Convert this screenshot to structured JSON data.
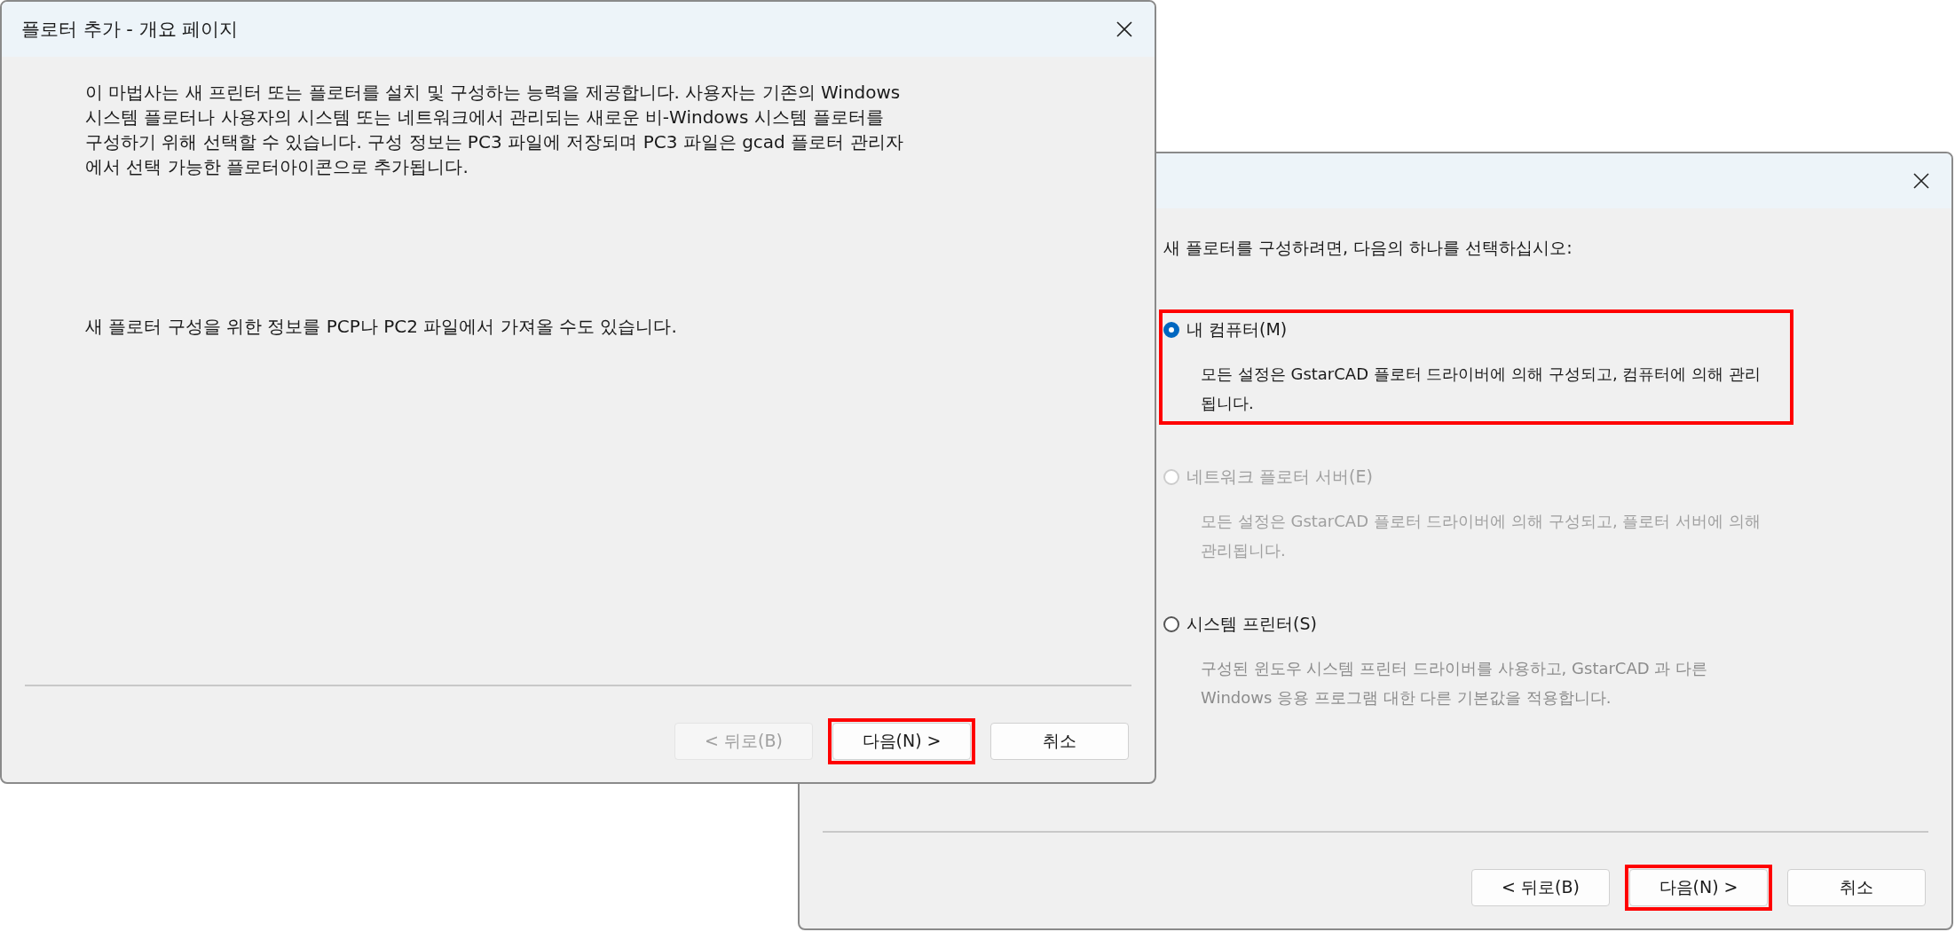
{
  "windows": [
    {
      "title": "플로터 추가 - 개요 페이지",
      "paragraphs": [
        "이 마법사는 새 프린터 또는 플로터를 설치 및 구성하는 능력을 제공합니다. 사용자는 기존의 Windows 시스템 플로터나 사용자의 시스템 또는 네트워크에서 관리되는 새로운 비-Windows 시스템 플로터를 구성하기 위해 선택할 수 있습니다. 구성 정보는 PC3 파일에 저장되며 PC3 파일은 gcad 플로터 관리자에서 선택 가능한 플로터아이콘으로 추가됩니다.",
        "새 플로터 구성을 위한 정보를 PCP나 PC2 파일에서 가져올 수도 있습니다."
      ],
      "buttons": [
        {
          "label": "< 뒤로(B)",
          "disabled": true,
          "highlighted": false
        },
        {
          "label": "다음(N) >",
          "disabled": false,
          "highlighted": true
        },
        {
          "label": "취소",
          "disabled": false,
          "highlighted": false
        }
      ]
    },
    {
      "intro": "새 플로터를 구성하려면, 다음의 하나를 선택하십시오:",
      "options": [
        {
          "label": "내 컴퓨터(M)",
          "description": "모든 설정은 GstarCAD 플로터 드라이버에 의해 구성되고, 컴퓨터에 의해 관리됩니다.",
          "selected": true,
          "disabled": false,
          "highlighted": true
        },
        {
          "label": "네트워크 플로터 서버(E)",
          "description": "모든 설정은 GstarCAD 플로터 드라이버에 의해 구성되고, 플로터 서버에 의해 관리됩니다.",
          "selected": false,
          "disabled": true,
          "highlighted": false
        },
        {
          "label": "시스템 프린터(S)",
          "description": "구성된 윈도우 시스템 프린터 드라이버를 사용하고, GstarCAD 과 다른 Windows 응용 프로그램 대한 다른 기본값을 적용합니다.",
          "selected": false,
          "disabled": false,
          "highlighted": false
        }
      ],
      "buttons": [
        {
          "label": "< 뒤로(B)",
          "disabled": false,
          "highlighted": false
        },
        {
          "label": "다음(N) >",
          "disabled": false,
          "highlighted": true
        },
        {
          "label": "취소",
          "disabled": false,
          "highlighted": false
        }
      ]
    }
  ]
}
